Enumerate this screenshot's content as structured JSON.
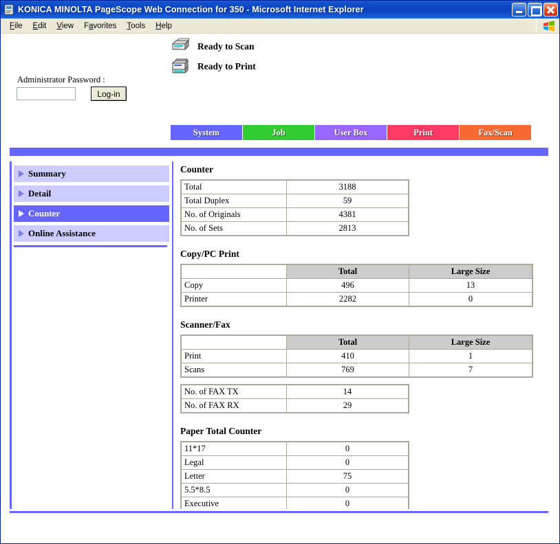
{
  "window": {
    "title": "KONICA MINOLTA PageScope Web Connection for 350 - Microsoft Internet Explorer",
    "icon": "pagescope-icon",
    "minimize_label": "Minimize",
    "maximize_label": "Maximize",
    "close_label": "Close"
  },
  "menubar": {
    "items": [
      {
        "label": "File",
        "accel": "F"
      },
      {
        "label": "Edit",
        "accel": "E"
      },
      {
        "label": "View",
        "accel": "V"
      },
      {
        "label": "Favorites",
        "accel": "a"
      },
      {
        "label": "Tools",
        "accel": "T"
      },
      {
        "label": "Help",
        "accel": "H"
      }
    ]
  },
  "status": {
    "scan": "Ready to Scan",
    "print": "Ready to Print"
  },
  "login": {
    "label": "Administrator Password :",
    "value": "",
    "placeholder": "",
    "button": "Log-in"
  },
  "tabs": [
    {
      "label": "System",
      "color": "#6666ff"
    },
    {
      "label": "Job",
      "color": "#33cc33"
    },
    {
      "label": "User Box",
      "color": "#9966ff"
    },
    {
      "label": "Print",
      "color": "#f93a63"
    },
    {
      "label": "Fax/Scan",
      "color": "#f86a33"
    }
  ],
  "sidebar": {
    "items": [
      {
        "label": "Summary",
        "active": false
      },
      {
        "label": "Detail",
        "active": false
      },
      {
        "label": "Counter",
        "active": true
      },
      {
        "label": "Online Assistance",
        "active": false
      }
    ]
  },
  "main": {
    "counter": {
      "title": "Counter",
      "rows": [
        {
          "label": "Total",
          "value": "3188"
        },
        {
          "label": "Total Duplex",
          "value": "59"
        },
        {
          "label": "No. of Originals",
          "value": "4381"
        },
        {
          "label": "No. of Sets",
          "value": "2813"
        }
      ]
    },
    "copy_pc_print": {
      "title": "Copy/PC Print",
      "headers": [
        "",
        "Total",
        "Large Size"
      ],
      "rows": [
        {
          "label": "Copy",
          "total": "496",
          "large": "13"
        },
        {
          "label": "Printer",
          "total": "2282",
          "large": "0"
        }
      ]
    },
    "scanner_fax": {
      "title": "Scanner/Fax",
      "headers": [
        "",
        "Total",
        "Large Size"
      ],
      "rows": [
        {
          "label": "Print",
          "total": "410",
          "large": "1"
        },
        {
          "label": "Scans",
          "total": "769",
          "large": "7"
        }
      ],
      "fax_rows": [
        {
          "label": "No. of FAX TX",
          "value": "14"
        },
        {
          "label": "No. of FAX RX",
          "value": "29"
        }
      ]
    },
    "paper_total_counter": {
      "title": "Paper Total Counter",
      "rows": [
        {
          "label": "11*17",
          "value": "0"
        },
        {
          "label": "Legal",
          "value": "0"
        },
        {
          "label": "Letter",
          "value": "75"
        },
        {
          "label": "5.5*8.5",
          "value": "0"
        },
        {
          "label": "Executive",
          "value": "0"
        }
      ]
    }
  },
  "colors": {
    "accent": "#6666ff",
    "nav_item": "#ccccff",
    "table_header": "#cccccc",
    "table_border": "#aca899"
  }
}
